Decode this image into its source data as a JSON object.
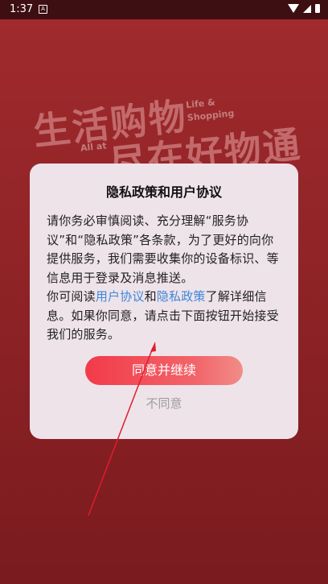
{
  "status_bar": {
    "time": "1:37",
    "notification_icon": "A"
  },
  "background": {
    "headline_1": "生活购物",
    "sub_1": "Life &",
    "sub_2": "Shopping",
    "all_at": "All at",
    "headline_2": "尽在好物通"
  },
  "dialog": {
    "title": "隐私政策和用户协议",
    "body_part1": "请你务必审慎阅读、充分理解“服务协议”和“隐私政策”各条款，为了更好的向你提供服务，我们需要收集你的设备标识、等信息用于登录及消息推送。",
    "body_part2_prefix": "你可阅读",
    "link_user_agreement": "用户协议",
    "conj_and": "和",
    "link_privacy_policy": "隐私政策",
    "body_part2_suffix": "了解详细信息。如果你同意，请点击下面按钮开始接受我们的服务。",
    "agree_label": "同意并继续",
    "disagree_label": "不同意"
  },
  "colors": {
    "accent": "#f23a4a",
    "link": "#3d88d8",
    "background": "#8d2326"
  },
  "icons": [
    "wifi-icon",
    "signal-icon",
    "battery-icon",
    "notification-icon"
  ]
}
